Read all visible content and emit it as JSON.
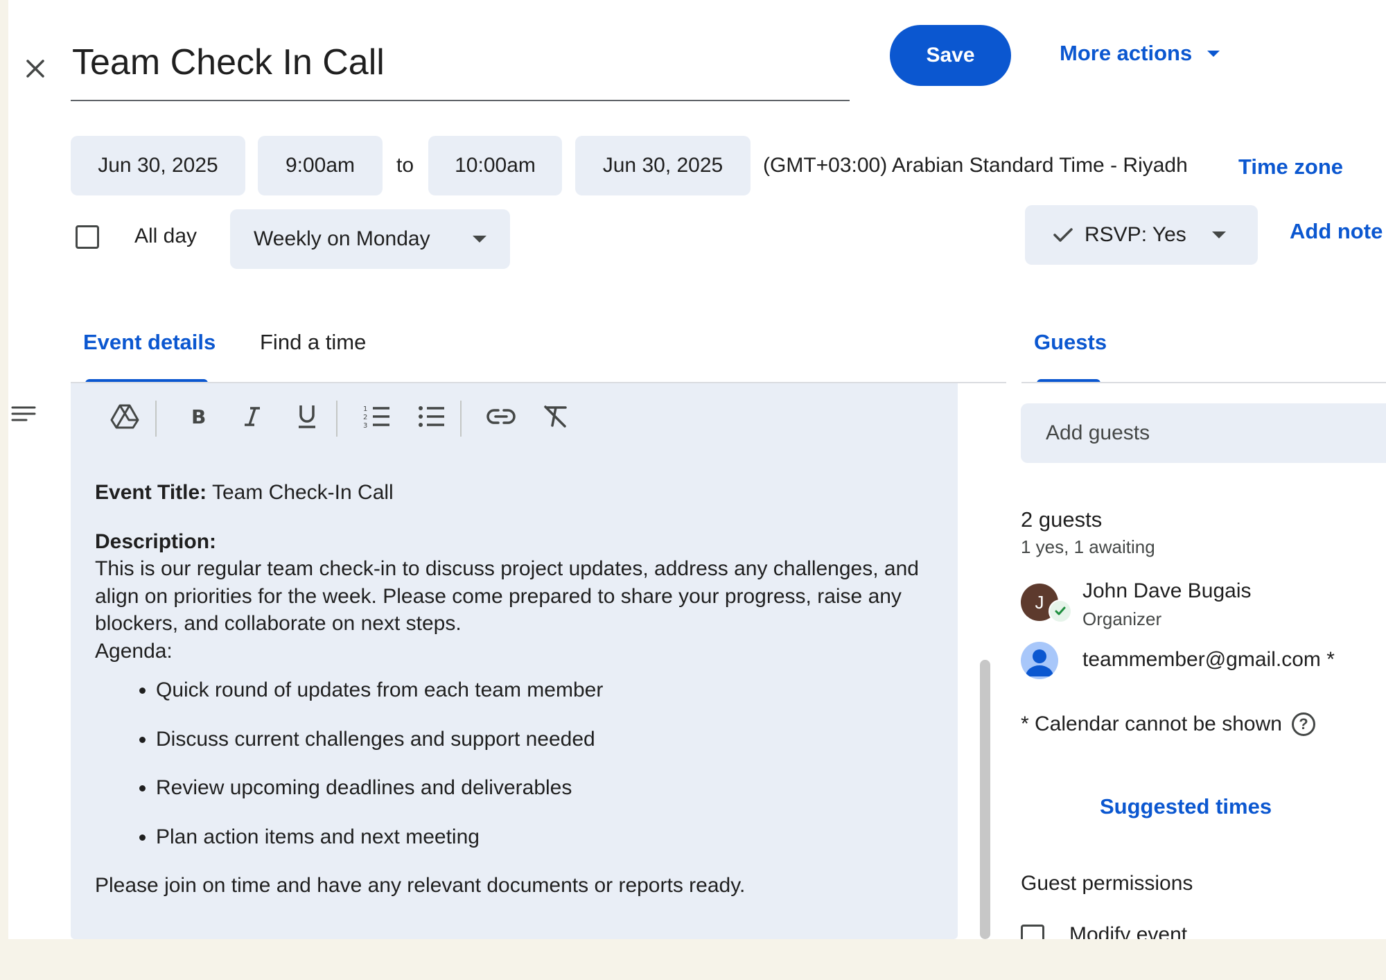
{
  "header": {
    "close_icon": "close-icon",
    "title": "Team Check In Call",
    "save_label": "Save",
    "more_actions_label": "More actions"
  },
  "datetime": {
    "start_date": "Jun 30, 2025",
    "start_time": "9:00am",
    "to_label": "to",
    "end_time": "10:00am",
    "end_date": "Jun 30, 2025",
    "timezone_text": "(GMT+03:00) Arabian Standard Time - Riyadh",
    "timezone_link": "Time zone"
  },
  "options": {
    "all_day_label": "All day",
    "all_day_checked": false,
    "recurrence": "Weekly on Monday",
    "rsvp": "RSVP: Yes",
    "add_note": "Add note"
  },
  "tabs": [
    {
      "label": "Event details",
      "active": true
    },
    {
      "label": "Find a time",
      "active": false
    }
  ],
  "guests_tab": {
    "label": "Guests",
    "active": true
  },
  "toolbar": {
    "icons": [
      "google-drive-icon",
      "bold-icon",
      "italic-icon",
      "underline-icon",
      "numbered-list-icon",
      "bulleted-list-icon",
      "link-icon",
      "clear-formatting-icon"
    ]
  },
  "description": {
    "title_label": "Event Title:",
    "title_value": "Team Check-In Call",
    "desc_label": "Description:",
    "desc_text": "This is our regular team check-in to discuss project updates, address any challenges, and align on priorities for the week. Please come prepared to share your progress, raise any blockers, and collaborate on next steps.",
    "agenda_label": "Agenda:",
    "agenda_items": [
      "Quick round of updates from each team member",
      "Discuss current challenges and support needed",
      "Review upcoming deadlines and deliverables",
      "Plan action items and next meeting"
    ],
    "closing": "Please join on time and have any relevant documents or reports ready."
  },
  "guests": {
    "add_placeholder": "Add guests",
    "count": "2 guests",
    "summary": "1 yes, 1 awaiting",
    "list": [
      {
        "initial": "J",
        "name": "John Dave Bugais",
        "role": "Organizer",
        "accepted": true
      },
      {
        "name": "teammember@gmail.com *",
        "role": ""
      }
    ],
    "calendar_note": "* Calendar cannot be shown",
    "suggested_times": "Suggested times",
    "permissions_title": "Guest permissions",
    "permission_items": [
      {
        "label": "Modify event",
        "checked": false
      }
    ]
  },
  "colors": {
    "accent": "#0b57d0",
    "field_bg": "#e9eef6",
    "page_bg": "#f6f3e9",
    "avatar_j": "#5d3a2d"
  }
}
